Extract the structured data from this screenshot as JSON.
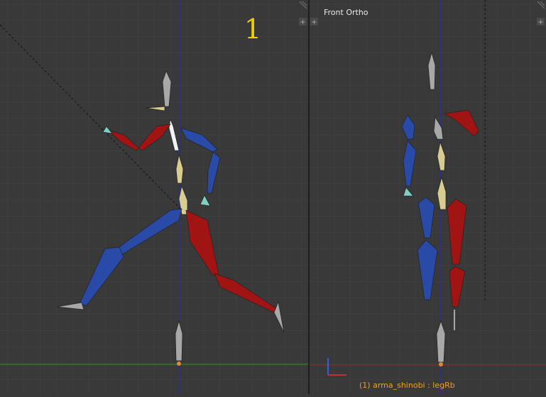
{
  "left_viewport": {
    "frame_number": "1"
  },
  "right_viewport": {
    "title": "Front Ortho",
    "status": "(1) arma_shinobi : legRb"
  },
  "colors": {
    "background": "#393939",
    "grid": "#444444",
    "divider": "#1f1f1f",
    "axis_vertical": "#2727c8",
    "axis_green": "#3c8a2c",
    "axis_red": "#9a2a2a",
    "bone_blue": "#2a4aa8",
    "bone_red": "#a01414",
    "bone_gray": "#a8a8a8",
    "bone_yellow": "#d8cc90",
    "bone_white": "#f2f2f2",
    "status_orange": "#f0a020",
    "frame_yellow": "#f0d000"
  },
  "icons": [
    "split-corner-icon",
    "viewport-expand-icon",
    "axis-gizmo-icon"
  ]
}
